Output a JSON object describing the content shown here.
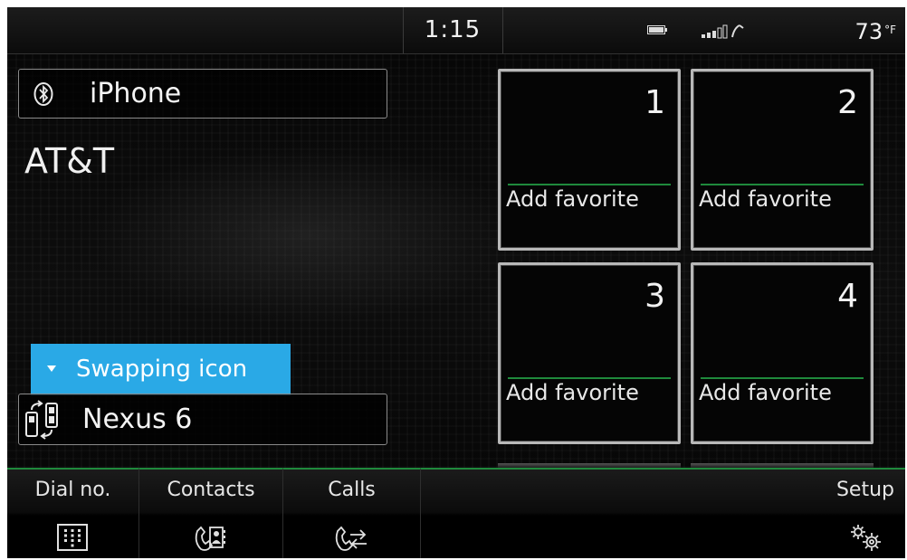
{
  "status_bar": {
    "time": "1:15",
    "temperature": "73",
    "temperature_unit": "°F",
    "icons": [
      "battery-icon",
      "signal-icon"
    ]
  },
  "phone": {
    "connection_icon": "bluetooth-icon",
    "device_label": "iPhone",
    "carrier": "AT&T"
  },
  "tooltip": {
    "text": "Swapping icon",
    "color": "#2aa9e6"
  },
  "secondary_device": {
    "icon": "phone-swap-icon",
    "name": "Nexus 6"
  },
  "favorites": [
    {
      "number": "1",
      "label": "Add favorite"
    },
    {
      "number": "2",
      "label": "Add favorite"
    },
    {
      "number": "3",
      "label": "Add favorite"
    },
    {
      "number": "4",
      "label": "Add favorite"
    }
  ],
  "bottom_tabs": [
    {
      "label": "Dial no.",
      "icon": "keypad-icon"
    },
    {
      "label": "Contacts",
      "icon": "contacts-icon"
    },
    {
      "label": "Calls",
      "icon": "call-log-icon"
    }
  ],
  "setup": {
    "label": "Setup",
    "icon": "gears-icon"
  },
  "colors": {
    "accent_green": "#1f8a3c",
    "tooltip_blue": "#2aa9e6",
    "background": "#060606"
  }
}
